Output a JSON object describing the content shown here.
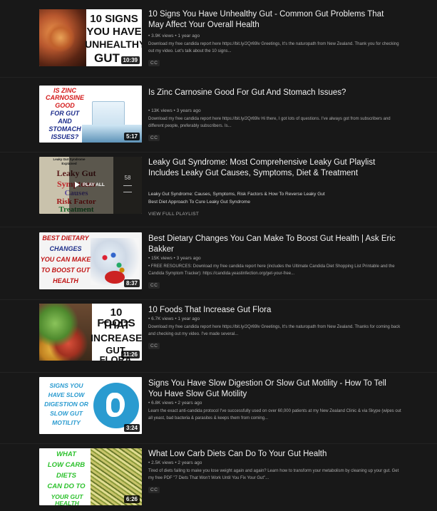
{
  "videos": [
    {
      "title": "10 Signs You Have Unhealthy Gut - Common Gut Problems That May Affect Your Overall Health",
      "meta": "• 3.9K views • 1 year ago",
      "desc": "Download my free candida report here https://bit.ly/2Qr69lv Greetings, It's the naturopath from New Zealand. Thank you for checking out my video. Let's talk about the 10 signs...",
      "cc": "CC",
      "duration": "10:39",
      "thumb_text": [
        "10 SIGNS",
        "YOU HAVE",
        "UNHEALTHY",
        "GUT"
      ]
    },
    {
      "title": "Is Zinc Carnosine Good For Gut And Stomach Issues?",
      "meta": "• 13K views • 3 years ago",
      "desc": "Download my free candida report here https://bit.ly/2Qr69lv Hi there, I got lots of questions. I've always got from subscribers and different people, preferably subscribers. Is...",
      "cc": "CC",
      "duration": "5:17",
      "thumb_text": [
        "IS ZINC",
        "CARNOSINE",
        "GOOD",
        "FOR GUT",
        "AND",
        "STOMACH",
        "ISSUES?"
      ]
    }
  ],
  "playlist": {
    "title": "Leaky Gut Syndrome: Most Comprehensive Leaky Gut Playlist Includes Leaky Gut Causes, Symptoms, Diet & Treatment",
    "items": [
      "Leaky Gut Syndrome: Causes, Symptoms, Risk Factors & How To Reverse Leaky Gut",
      "Best Diet Approach To Cure Leaky Gut Syndrome"
    ],
    "view_full": "VIEW FULL PLAYLIST",
    "play_all": "PLAY ALL",
    "count": "58",
    "thumb_text": [
      "Leaky Gut Syndrome",
      "Explained",
      "Leaky Gut",
      "Symptoms",
      "Causes",
      "Risk Factor",
      "Treatment"
    ]
  },
  "videos2": [
    {
      "title": "Best Dietary Changes You Can Make To Boost Gut Health | Ask Eric Bakker",
      "meta": "• 15K views • 3 years ago",
      "desc": "• FREE RESOURCES: Download my free candida report here (includes the Ultimate Candida Diet Shopping List Printable and the Candida Symptom Tracker): https://candida.yeastinfection.org/get-your-free...",
      "cc": "CC",
      "duration": "8:37",
      "thumb_text": [
        "BEST DIETARY",
        "CHANGES",
        "YOU CAN MAKE",
        "TO BOOST GUT",
        "HEALTH"
      ]
    },
    {
      "title": "10 Foods That Increase Gut Flora",
      "meta": "• 6.7K views • 1 year ago",
      "desc": "Download my free candida report here https://bit.ly/2Qr69lv Greetings, It's the naturopath from New Zealand. Thanks for coming back and checking out my video. I've made several...",
      "cc": "CC",
      "duration": "11:26",
      "thumb_text": [
        "10 FOODS",
        "THAT",
        "INCREASE",
        "GUT FLORA"
      ]
    },
    {
      "title": "Signs You Have Slow Digestion Or Slow Gut Motility - How To Tell You Have Slow Gut Motility",
      "meta": "• 6.8K views • 2 years ago",
      "desc": "Learn the exact anti-candida protocol I've successfully used on over 60,000 patients at my New Zealand Clinic & via Skype (wipes out all yeast, bad bacteria & parasites & keeps them from coming...",
      "cc": "",
      "duration": "3:24",
      "thumb_text": [
        "SIGNS YOU",
        "HAVE SLOW",
        "DIGESTION OR",
        "SLOW GUT",
        "MOTILITY"
      ]
    },
    {
      "title": "What Low Carb Diets Can Do To Your Gut Health",
      "meta": "• 2.5K views • 2 years ago",
      "desc": "Tired of diets failing to make you lose weight again and again? Learn how to transform your metabolism by cleaning up your gut. Get my free PDF \"7 Diets That Won't Work Until You Fix Your Gut\"...",
      "cc": "CC",
      "duration": "6:26",
      "thumb_text": [
        "WHAT",
        "LOW CARB",
        "DIETS",
        "CAN DO TO",
        "YOUR GUT HEALTH"
      ]
    }
  ]
}
